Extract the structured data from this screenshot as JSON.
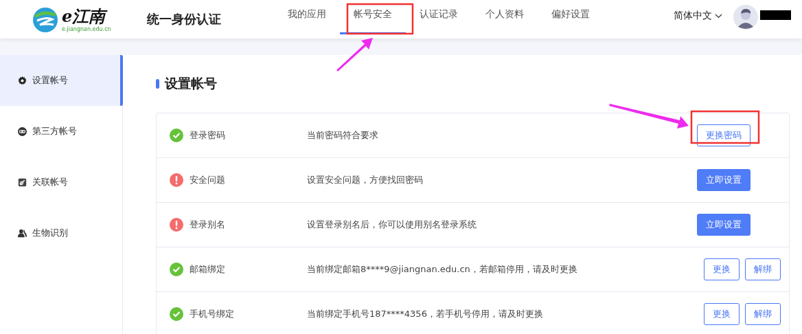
{
  "header": {
    "logo": {
      "mark": "e江南",
      "caption": "e.jiangnan.edu.cn"
    },
    "title": "统一身份认证",
    "nav": [
      {
        "label": "我的应用",
        "selected": false
      },
      {
        "label": "帐号安全",
        "selected": true
      },
      {
        "label": "认证记录",
        "selected": false
      },
      {
        "label": "个人资料",
        "selected": false
      },
      {
        "label": "偏好设置",
        "selected": false
      }
    ],
    "language": "简体中文"
  },
  "sidebar": {
    "items": [
      {
        "label": "设置帐号",
        "kind": "gear",
        "selected": true
      },
      {
        "label": "第三方帐号",
        "kind": "link",
        "selected": false
      },
      {
        "label": "关联帐号",
        "kind": "chain",
        "selected": false
      },
      {
        "label": "生物识别",
        "kind": "users",
        "selected": false
      }
    ]
  },
  "section": {
    "title": "设置帐号",
    "rows": [
      {
        "name": "登录密码",
        "kind": "ok",
        "description": "当前密码符合要求",
        "buttons": [
          {
            "label": "更换密码",
            "kind": "outline"
          }
        ]
      },
      {
        "name": "安全问题",
        "kind": "warn",
        "description": "设置安全问题，方便找回密码",
        "buttons": [
          {
            "label": "立即设置",
            "kind": "primary"
          }
        ]
      },
      {
        "name": "登录别名",
        "kind": "warn",
        "description": "设置登录别名后，你可以使用别名登录系统",
        "buttons": [
          {
            "label": "立即设置",
            "kind": "primary"
          }
        ]
      },
      {
        "name": "邮箱绑定",
        "kind": "ok",
        "description": "当前绑定邮箱8****9@jiangnan.edu.cn，若邮箱停用，请及时更换",
        "buttons": [
          {
            "label": "更换",
            "kind": "outline"
          },
          {
            "label": "解绑",
            "kind": "outline"
          }
        ]
      },
      {
        "name": "手机号绑定",
        "kind": "ok",
        "description": "当前绑定手机号187****4356，若手机号停用，请及时更换",
        "buttons": [
          {
            "label": "更换",
            "kind": "outline"
          },
          {
            "label": "解绑",
            "kind": "outline"
          }
        ]
      }
    ]
  }
}
